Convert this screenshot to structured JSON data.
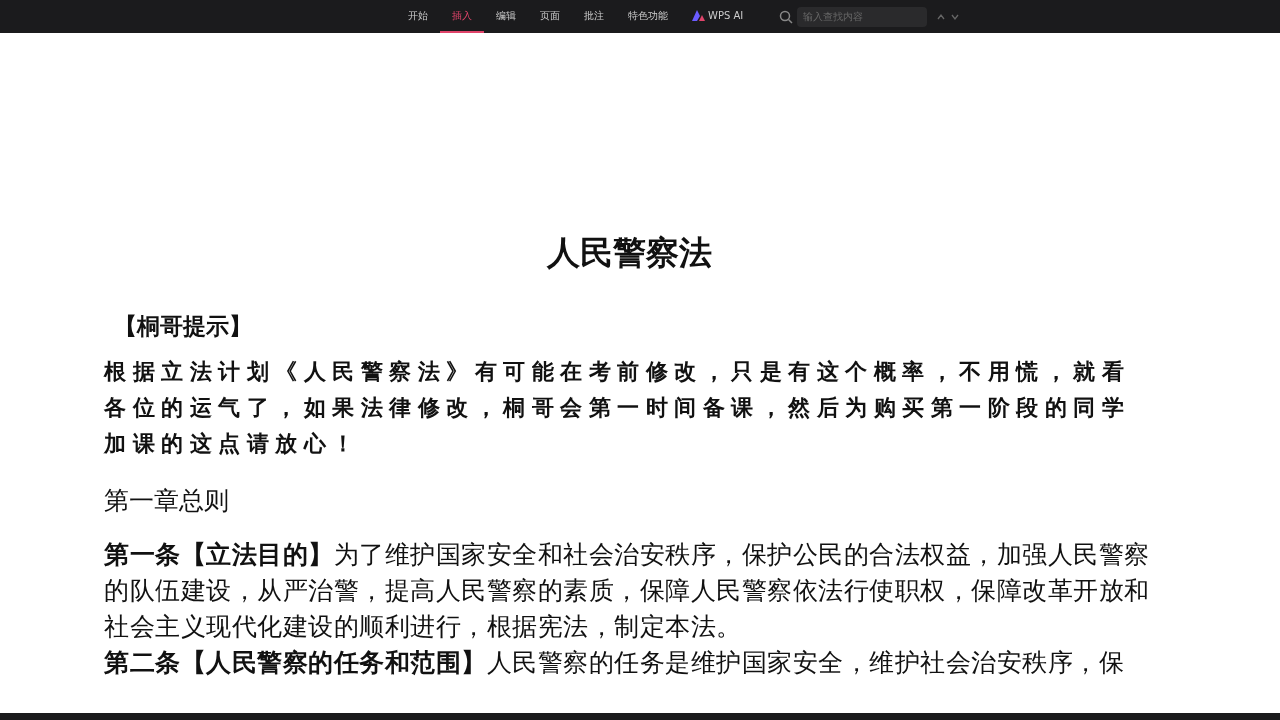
{
  "toolbar": {
    "tabs": [
      {
        "label": "开始",
        "selected": false
      },
      {
        "label": "插入",
        "selected": true
      },
      {
        "label": "编辑",
        "selected": false
      },
      {
        "label": "页面",
        "selected": false
      },
      {
        "label": "批注",
        "selected": false
      },
      {
        "label": "特色功能",
        "selected": false
      },
      {
        "label": "WPS AI",
        "selected": false,
        "kind": "ai"
      }
    ],
    "search": {
      "placeholder": "输入查找内容"
    }
  },
  "document": {
    "title": "人民警察法",
    "hint": {
      "heading": "【桐哥提示】",
      "text": "根据立法计划《人民警察法》有可能在考前修改，只是有这个概率，不用慌，就看各位的运气了，如果法律修改，桐哥会第一时间备课，然后为购买第一阶段的同学加课的这点请放心！"
    },
    "chapter": "第一章总则",
    "articles": [
      "**第一条【立法目的】**为了维护国家安全和社会治安秩序，保护公民的合法权益，加强人民警察的队伍建设，从严治警，提高人民警察的素质，保障人民警察依法行使职权，保障改革开放和社会主义现代化建设的顺利进行，根据宪法，制定本法。",
      "**第二条【人民警察的任务和范围】**人民警察的任务是维护国家安全，维护社会治安秩序，保"
    ]
  }
}
